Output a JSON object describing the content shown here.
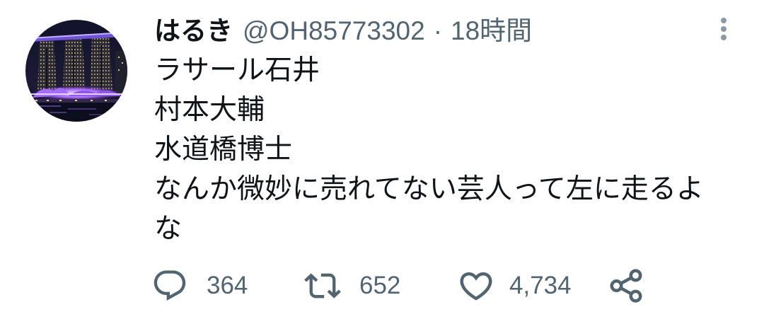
{
  "tweet": {
    "author": {
      "display_name": "はるき",
      "handle": "@OH85773302"
    },
    "separator": "·",
    "timestamp": "18時間",
    "text_lines": [
      "ラサール石井",
      "村本大輔",
      "水道橋博士",
      "なんか微妙に売れてない芸人って左に走るよな"
    ],
    "actions": {
      "reply": {
        "icon": "reply-icon",
        "count": "364"
      },
      "retweet": {
        "icon": "retweet-icon",
        "count": "652"
      },
      "like": {
        "icon": "heart-icon",
        "count": "4,734"
      },
      "share": {
        "icon": "share-icon"
      }
    },
    "more_icon": "more-vertical-icon"
  },
  "colors": {
    "background": "#ffffff",
    "text_primary": "#0f1419",
    "text_secondary": "#536471",
    "more_icon": "#8b98a5"
  }
}
